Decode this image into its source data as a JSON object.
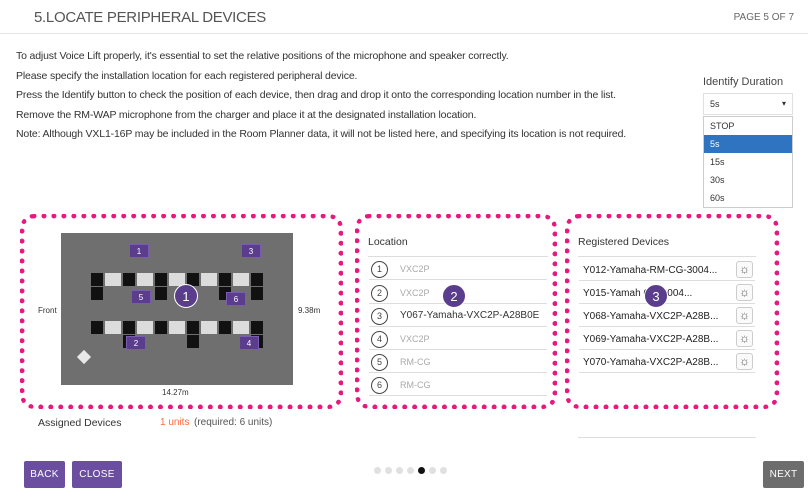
{
  "header": {
    "title": "5.LOCATE PERIPHERAL DEVICES",
    "page": "PAGE 5 OF 7"
  },
  "instructions": [
    "To adjust Voice Lift properly, it's essential to set the relative positions of the microphone and speaker correctly.",
    "Please specify the installation location for each registered peripheral device.",
    "Press the Identify button to check the position of each device, then drag and drop it onto the corresponding location number in the list.",
    "Remove the RM-WAP microphone from the charger and place it at the designated installation location.",
    "Note: Although VXL1-16P may be included in the Room Planner data, it will not be listed here, and specifying its location is not required."
  ],
  "identify": {
    "label": "Identify Duration",
    "selected": "5s",
    "options": [
      "STOP",
      "5s",
      "15s",
      "30s",
      "60s"
    ],
    "selected_index": 1
  },
  "floorplan": {
    "front_label": "Front",
    "height_label": "9.38m",
    "width_label": "14.27m",
    "markers": [
      "1",
      "2",
      "3",
      "4",
      "5",
      "6"
    ]
  },
  "callouts": [
    "1",
    "2",
    "3"
  ],
  "location": {
    "title": "Location",
    "rows": [
      {
        "num": "1",
        "text": "VXC2P"
      },
      {
        "num": "2",
        "text": "VXC2P"
      },
      {
        "num": "3",
        "text": "Y067-Yamaha-VXC2P-A28B0E"
      },
      {
        "num": "4",
        "text": "VXC2P"
      },
      {
        "num": "5",
        "text": "RM-CG"
      },
      {
        "num": "6",
        "text": "RM-CG"
      }
    ]
  },
  "registered": {
    "title": "Registered Devices",
    "rows": [
      "Y012-Yamaha-RM-CG-3004...",
      "Y015-Yamah   CG-3004...",
      "Y068-Yamaha-VXC2P-A28B...",
      "Y069-Yamaha-VXC2P-A28B...",
      "Y070-Yamaha-VXC2P-A28B..."
    ]
  },
  "assigned": {
    "label": "Assigned Devices",
    "count": "1 units",
    "required": "(required: 6 units)"
  },
  "buttons": {
    "back": "BACK",
    "close": "CLOSE",
    "next": "NEXT"
  },
  "pagination": {
    "total": 7,
    "current": 5
  },
  "colors": {
    "accent": "#6b4ea0",
    "callout": "#e6197f",
    "selected_option": "#2f74c0",
    "assigned_count": "#ff6a3d"
  }
}
